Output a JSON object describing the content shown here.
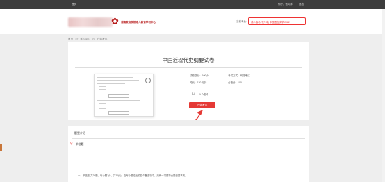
{
  "topbar": {
    "left_link": "首页",
    "user": "你好，张同学",
    "logout": "退出"
  },
  "header": {
    "logo_text": "湖南教育学院成人教育学习中心",
    "switch_label": "当前专业:",
    "switch_value": "成人高考(专升本) 中国语言文学 2022"
  },
  "breadcrumb": {
    "items": [
      "首页",
      ">>",
      "学习中心",
      ">>",
      "在线考试"
    ]
  },
  "exam": {
    "title": "中国近现代史纲要试卷",
    "total_score_label": "试卷总分：100 分",
    "exam_mode_label": "考试方式：网络考试",
    "duration_label": "时长：120 分钟",
    "pass_label": "合格分：100",
    "people_label": "1 人参考",
    "enter_button": "开始考试"
  },
  "intro": {
    "title": "题型介绍",
    "section": "单选题",
    "description": "一、单选题(共20题，每小题2分，共20分)。在每小题给出的四个备选项中，只有一项是符合题目要求的。"
  },
  "colors": {
    "accent": "#e53935",
    "topbar": "#3d3d3d",
    "background": "#eeeeee"
  }
}
